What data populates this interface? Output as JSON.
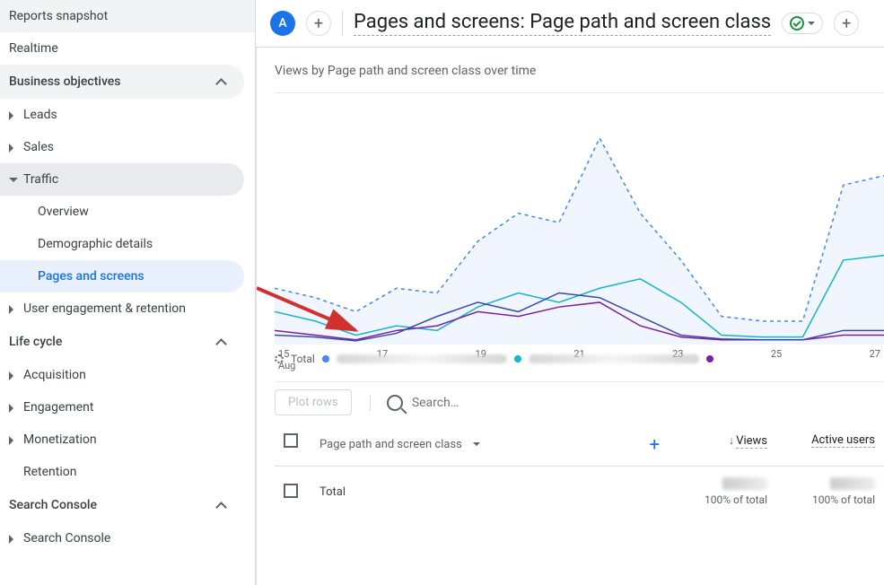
{
  "sidebar": {
    "reports_snapshot": "Reports snapshot",
    "realtime": "Realtime",
    "groups": [
      {
        "label": "Business objectives",
        "items": [
          {
            "label": "Leads"
          },
          {
            "label": "Sales"
          },
          {
            "label": "Traffic",
            "expanded": true,
            "sub": [
              {
                "label": "Overview"
              },
              {
                "label": "Demographic details"
              },
              {
                "label": "Pages and screens",
                "active": true
              }
            ]
          },
          {
            "label": "User engagement & retention"
          }
        ]
      },
      {
        "label": "Life cycle",
        "items": [
          {
            "label": "Acquisition"
          },
          {
            "label": "Engagement"
          },
          {
            "label": "Monetization"
          },
          {
            "label": "Retention"
          }
        ]
      },
      {
        "label": "Search Console",
        "items": [
          {
            "label": "Search Console"
          }
        ]
      }
    ]
  },
  "header": {
    "avatar": "A",
    "title": "Pages and screens: Page path and screen class"
  },
  "chart_data": {
    "type": "line",
    "title": "Views by Page path and screen class over time",
    "xlabel": "Aug",
    "x": [
      "15",
      "17",
      "19",
      "21",
      "23",
      "25",
      "27"
    ],
    "x_sub": "Aug",
    "ylim": [
      0,
      220
    ],
    "series": [
      {
        "name": "Total",
        "style": "dashed",
        "color": "#4285f4",
        "values": [
          60,
          50,
          35,
          60,
          55,
          110,
          140,
          130,
          220,
          140,
          90,
          30,
          25,
          25,
          170,
          180
        ]
      },
      {
        "name": "series1",
        "style": "solid",
        "color": "#12b5cb",
        "values": [
          35,
          25,
          10,
          20,
          15,
          40,
          55,
          45,
          60,
          70,
          45,
          10,
          8,
          8,
          90,
          95
        ]
      },
      {
        "name": "series2",
        "style": "solid",
        "color": "#7b1fa2",
        "values": [
          15,
          10,
          5,
          15,
          20,
          35,
          30,
          40,
          45,
          20,
          8,
          5,
          5,
          5,
          10,
          10
        ]
      },
      {
        "name": "series3",
        "style": "solid",
        "color": "#3949ab",
        "values": [
          10,
          8,
          4,
          12,
          30,
          45,
          35,
          55,
          50,
          30,
          10,
          6,
          5,
          5,
          15,
          15
        ]
      }
    ],
    "legend": [
      "Total"
    ]
  },
  "table": {
    "plot_rows": "Plot rows",
    "search_placeholder": "Search…",
    "dimension": "Page path and screen class",
    "metrics": [
      "Views",
      "Active users"
    ],
    "rows": [
      {
        "label": "Total",
        "views_pct": "100% of total",
        "active_pct": "100% of total"
      }
    ]
  }
}
